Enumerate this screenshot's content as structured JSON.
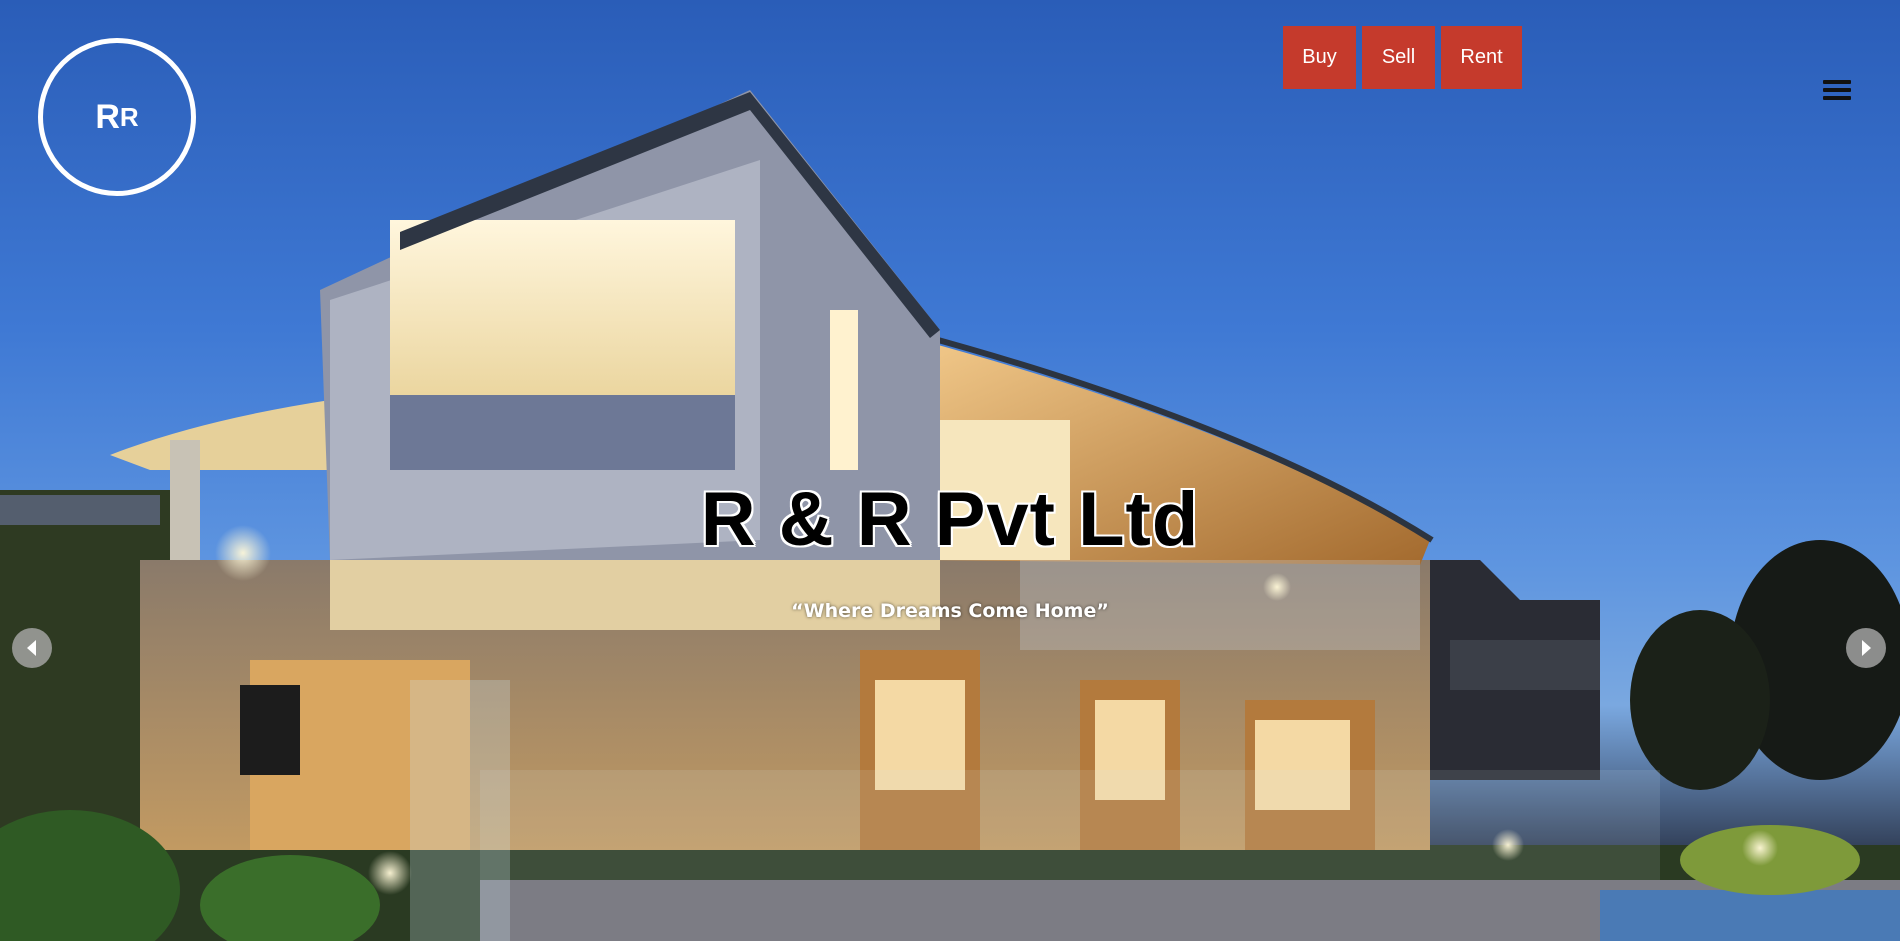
{
  "brand": {
    "logo_big": "R",
    "logo_small": "R"
  },
  "nav": {
    "buy": "Buy",
    "sell": "Sell",
    "rent": "Rent"
  },
  "hero": {
    "title": "R & R Pvt Ltd",
    "tagline": "“Where Dreams Come Home”"
  },
  "icons": {
    "menu": "hamburger-icon",
    "prev": "chevron-left-icon",
    "next": "chevron-right-icon"
  },
  "colors": {
    "accent": "#c53a2c",
    "sky": "#3f79d4"
  }
}
